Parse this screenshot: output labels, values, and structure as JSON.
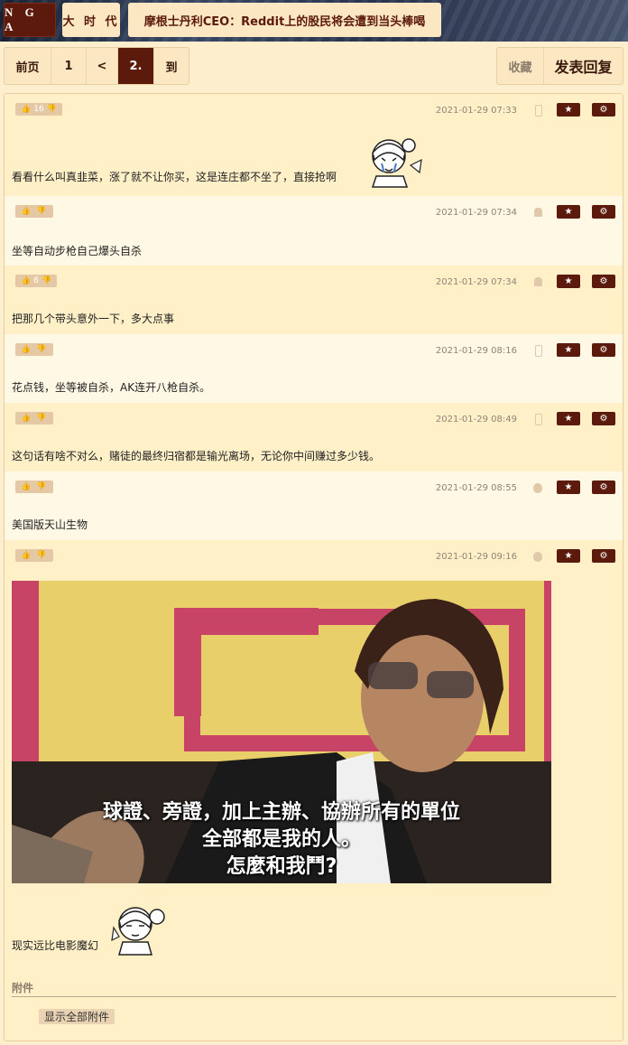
{
  "header": {
    "logo": "N G A",
    "forum": "大 时 代",
    "thread_title": "摩根士丹利CEO：Reddit上的股民将会遭到当头棒喝"
  },
  "pager": {
    "first": "前页",
    "page1": "1",
    "prev": "<",
    "current": "2.",
    "goto": "到"
  },
  "actions": {
    "favorite": "收藏",
    "reply": "发表回复"
  },
  "posts": [
    {
      "votes": "16",
      "time": "2021-01-29 07:33",
      "device": "phone-icon",
      "text": "看看什么叫真韭菜，涨了就不让你买，这是连庄都不坐了，直接抢啊"
    },
    {
      "votes": "",
      "time": "2021-01-29 07:34",
      "device": "android-icon",
      "text": "坐等自动步枪自己爆头自杀"
    },
    {
      "votes": "6",
      "time": "2021-01-29 07:34",
      "device": "android-icon",
      "text": "把那几个带头意外一下，多大点事"
    },
    {
      "votes": "",
      "time": "2021-01-29 08:16",
      "device": "phone-icon",
      "text": "花点钱，坐等被自杀，AK连开八枪自杀。"
    },
    {
      "votes": "",
      "time": "2021-01-29 08:49",
      "device": "phone-icon",
      "text": "这句话有啥不对么，赌徒的最终归宿都是输光离场，无论你中间赚过多少钱。"
    },
    {
      "votes": "",
      "time": "2021-01-29 08:55",
      "device": "apple-icon",
      "text": "美国版天山生物"
    },
    {
      "votes": "",
      "time": "2021-01-29 09:16",
      "device": "apple-icon",
      "text": "现实远比电影魔幻"
    }
  ],
  "image_subtitle": {
    "line1": "球證、旁證，加上主辦、協辦所有的單位",
    "line2": "全部都是我的人。",
    "line3": "怎麼和我鬥?"
  },
  "attachments": {
    "label": "附件",
    "show_all": "显示全部附件"
  },
  "colors": {
    "brand": "#5c1a0c",
    "row_a": "#fff0c8",
    "row_b": "#fff8e4",
    "page_bg": "#fdeecd"
  }
}
